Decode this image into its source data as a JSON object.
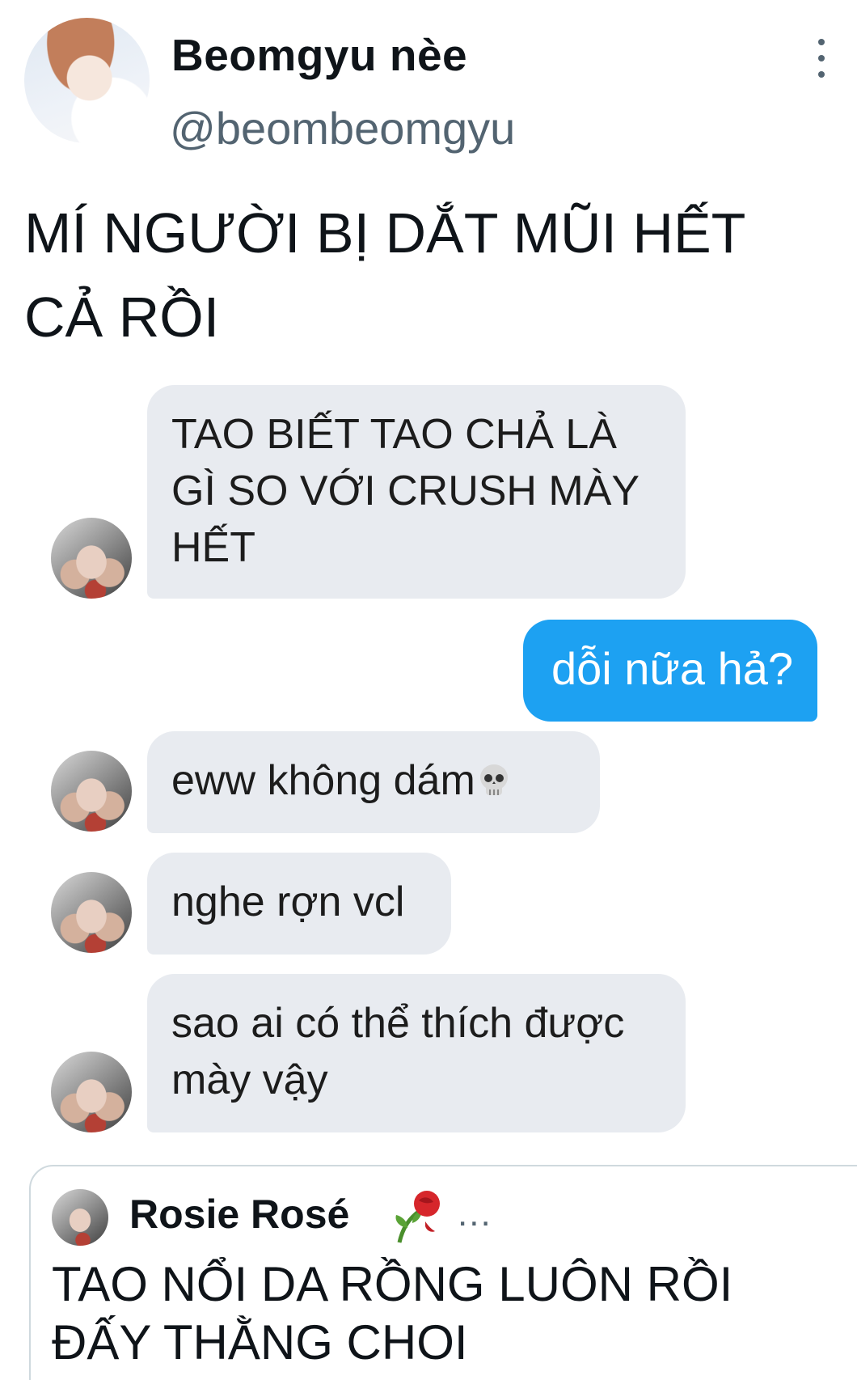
{
  "tweet": {
    "display_name": "Beomgyu nèe",
    "handle": "@beombeomgyu",
    "text": "MÍ NGƯỜI BỊ DẮT MŨI HẾT CẢ RỒI"
  },
  "chat": {
    "messages": [
      {
        "side": "left",
        "text": "TAO BIẾT TAO CHẢ LÀ GÌ SO VỚI CRUSH MÀY HẾT"
      },
      {
        "side": "right",
        "text": "dỗi nữa hả?"
      },
      {
        "side": "left",
        "text": "eww không dám",
        "trailing_icon": "skull-emoji"
      },
      {
        "side": "left",
        "text": "nghe rợn vcl"
      },
      {
        "side": "left",
        "text": "sao ai có thể thích được mày vậy"
      }
    ]
  },
  "quoted_tweet": {
    "display_name": "Rosie Rosé",
    "name_icon": "wilted-rose-emoji",
    "truncation": "...",
    "text": "TAO NỔI DA RỒNG LUÔN RỒI ĐẤY THẰNG CHOI"
  },
  "colors": {
    "sent_bubble": "#1da1f2",
    "received_bubble": "#e8ebf0",
    "secondary_text": "#536471"
  }
}
